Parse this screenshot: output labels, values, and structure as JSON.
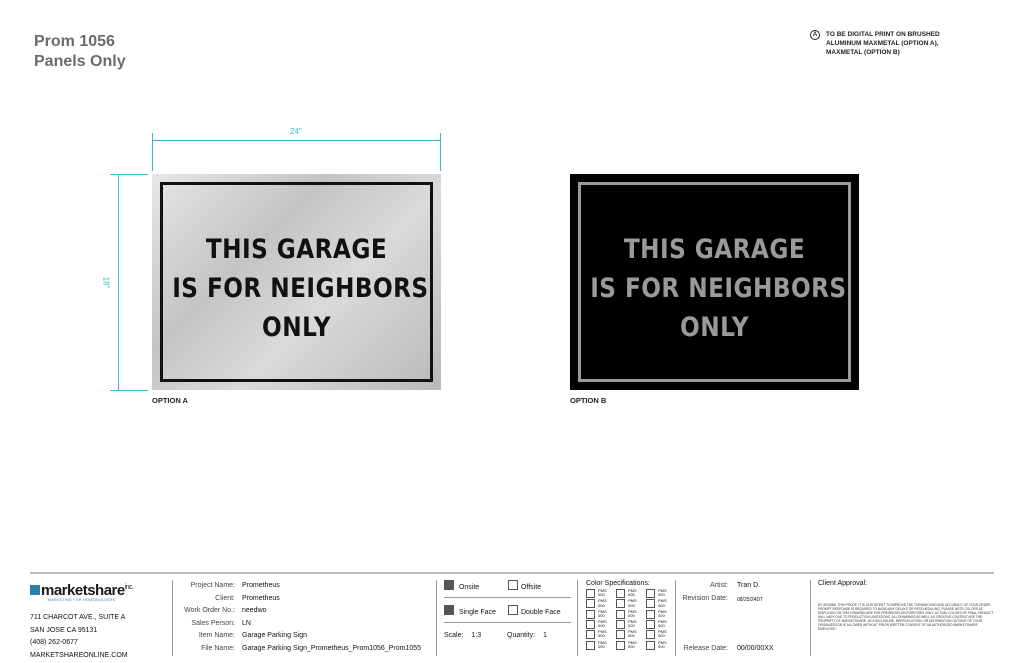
{
  "header": {
    "title_line1": "Prom 1056",
    "title_line2": "Panels Only",
    "note_marker": "A",
    "note_text": "TO BE DIGITAL PRINT ON BRUSHED ALUMINUM MAXMETAL (OPTION A), MAXMETAL (OPTION B)"
  },
  "dimensions": {
    "width": "24\"",
    "height": "18\""
  },
  "options": [
    {
      "label": "OPTION A",
      "lines": [
        "THIS GARAGE",
        "IS FOR NEIGHBORS",
        "ONLY"
      ]
    },
    {
      "label": "OPTION B",
      "lines": [
        "THIS GARAGE",
        "IS FOR NEIGHBORS",
        "ONLY"
      ]
    }
  ],
  "footer": {
    "logo": {
      "name": "marketshare",
      "suffix": "inc.",
      "tagline": "MARKETING FOR HOMEBUILDERS"
    },
    "address": [
      "711 CHARCOT AVE., SUITE A",
      "SAN JOSE CA 95131",
      "(408) 262-0677",
      "MARKETSHAREONLINE.COM"
    ],
    "project": {
      "project_name_label": "Project Name:",
      "project_name": "Prometheus",
      "client_label": "Client:",
      "client": "Prometheus",
      "work_order_label": "Work Order No.:",
      "work_order": "needwo",
      "sales_label": "Sales Person:",
      "sales": "LN",
      "item_label": "Item Name:",
      "item": "Garage Parking Sign",
      "file_label": "File Name:",
      "file": "Garage Parking Sign_Prometheus_Prom1056_Prom1055"
    },
    "install": {
      "onsite": "Onsite",
      "offsite": "Offsite",
      "single_face": "Single Face",
      "double_face": "Double Face",
      "scale_label": "Scale:",
      "scale": "1:3",
      "quantity_label": "Quantity:",
      "quantity": "1"
    },
    "color_spec": {
      "label": "Color Specifications:",
      "pms_label": "PMS",
      "pms_value": "000"
    },
    "artist": {
      "artist_label": "Artist:",
      "artist": "Tran D.",
      "revision_label": "Revision Date:",
      "revision": "08/25/24DT",
      "release_label": "Release Date:",
      "release": "00/00/00XX"
    },
    "approval": {
      "label": "Client Approval:",
      "legal": "BY SIGNING THIS PROOF, IT IS OUR INTENT TO IMPROVE THE TURNAROUND AND ACCURACY OF YOUR ORDER. PROMPT RESPONSE IS REQUIRED TO AVOID ANY DELAYS OR RESCHEDULING. PLEASE NOTE COLORS AS DISPLAYED ON THIS DRAWING ARE FOR PRESENTATION PURPOSES ONLY. ACTUAL COLORS OF FINAL PRODUCT WILL VARY DUE TO PRODUCTION LIMITATIONS. ALL DRAWINGS AS WELL AS CREATIVE CONTENT ARE THE PROPERTY OF MARKETSHARE. NO DISCLOSURE, REPRODUCTION, OR DISTRIBUTION OUTSIDE OF YOUR ORGANIZATION IS ALLOWED WITHOUT PRIOR WRITTEN CONSENT OF AN AUTHORIZED MARKETSHARE EMPLOYEE."
    }
  }
}
